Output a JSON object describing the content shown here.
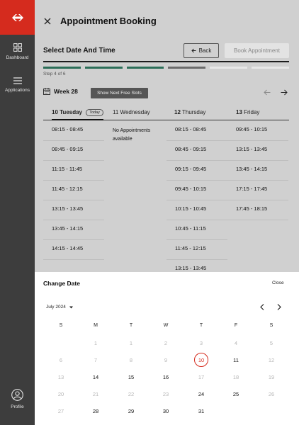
{
  "sidebar": {
    "items": [
      {
        "label": "Dashboard",
        "icon": "dashboard-icon"
      },
      {
        "label": "Applications",
        "icon": "menu-icon"
      }
    ],
    "profile": {
      "label": "Profile",
      "icon": "profile-icon"
    },
    "brand_color": "#d52b1e"
  },
  "header": {
    "title": "Appointment Booking"
  },
  "step": {
    "title": "Select Date And Time",
    "back_label": "Back",
    "book_label": "Book Appointment",
    "step_label": "Step 4 of 6",
    "current": 4,
    "total": 6
  },
  "week": {
    "label": "Week 28",
    "next_slots_label": "Show Next Free Slots"
  },
  "days": [
    {
      "num": "10",
      "name": "Tuesday",
      "badge": "Today",
      "active": true
    },
    {
      "num": "11",
      "name": "Wednesday"
    },
    {
      "num": "12",
      "name": "Thursday"
    },
    {
      "num": "13",
      "name": "Friday"
    }
  ],
  "slots": {
    "col0": [
      "08:15 - 08:45",
      "08:45 - 09:15",
      "11:15 - 11:45",
      "11:45 - 12:15",
      "13:15 - 13:45",
      "13:45 - 14:15",
      "14:15 - 14:45"
    ],
    "col1_empty": "No Appointments available",
    "col2": [
      "08:15 - 08:45",
      "08:45 - 09:15",
      "09:15 - 09:45",
      "09:45 - 10:15",
      "10:15 - 10:45",
      "10:45 - 11:15",
      "11:45 - 12:15",
      "13:15 - 13:45"
    ],
    "col3": [
      "09:45 - 10:15",
      "13:15 - 13:45",
      "13:45 - 14:15",
      "17:15 - 17:45",
      "17:45 - 18:15"
    ]
  },
  "calendar": {
    "title": "Change Date",
    "close_label": "Close",
    "month_label": "July 2024",
    "weekdays": [
      "S",
      "M",
      "T",
      "W",
      "T",
      "F",
      "S"
    ],
    "rows": [
      [
        {
          "d": "",
          "m": true
        },
        {
          "d": "1",
          "m": true
        },
        {
          "d": "1",
          "m": true
        },
        {
          "d": "2",
          "m": true
        },
        {
          "d": "3",
          "m": true
        },
        {
          "d": "4",
          "m": true
        },
        {
          "d": "5",
          "m": true
        }
      ],
      [
        {
          "d": "6",
          "m": true
        },
        {
          "d": "7",
          "m": true
        },
        {
          "d": "8",
          "m": true
        },
        {
          "d": "9",
          "m": true
        },
        {
          "d": "10",
          "today": true
        },
        {
          "d": "11"
        },
        {
          "d": "12",
          "m": true
        }
      ],
      [
        {
          "d": "13",
          "m": true
        },
        {
          "d": "14"
        },
        {
          "d": "15"
        },
        {
          "d": "16"
        },
        {
          "d": "17",
          "m": true
        },
        {
          "d": "18",
          "m": true
        },
        {
          "d": "19",
          "m": true
        }
      ],
      [
        {
          "d": "20",
          "m": true
        },
        {
          "d": "21",
          "m": true
        },
        {
          "d": "22",
          "m": true
        },
        {
          "d": "23",
          "m": true
        },
        {
          "d": "24"
        },
        {
          "d": "25"
        },
        {
          "d": "26",
          "m": true
        }
      ],
      [
        {
          "d": "27",
          "m": true
        },
        {
          "d": "28"
        },
        {
          "d": "29"
        },
        {
          "d": "30"
        },
        {
          "d": "31"
        },
        {
          "d": "",
          "m": true
        },
        {
          "d": "",
          "m": true
        }
      ]
    ],
    "today_color": "#d52b1e"
  }
}
